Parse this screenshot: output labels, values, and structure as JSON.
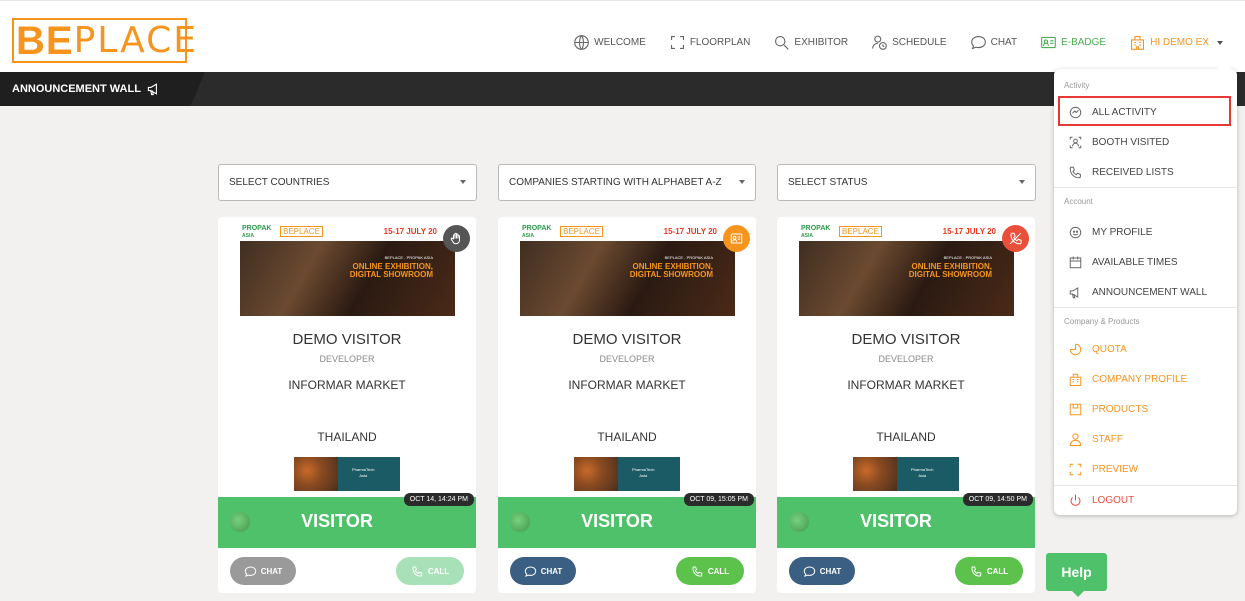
{
  "header": {
    "logo_be": "BE",
    "logo_place": "PLACE",
    "nav": [
      {
        "label": "WELCOME",
        "icon": "globe-icon"
      },
      {
        "label": "FLOORPLAN",
        "icon": "floorplan-icon"
      },
      {
        "label": "EXHIBITOR",
        "icon": "search-icon"
      },
      {
        "label": "SCHEDULE",
        "icon": "schedule-icon"
      },
      {
        "label": "CHAT",
        "icon": "chat-icon"
      },
      {
        "label": "E-BADGE",
        "icon": "badge-icon"
      },
      {
        "label": "HI DEMO EX",
        "icon": "building-icon"
      }
    ]
  },
  "announcement": {
    "label": "ANNOUNCEMENT WALL"
  },
  "filters": {
    "countries": "SELECT COUNTRIES",
    "alphabet": "COMPANIES STARTING WITH ALPHABET A-Z",
    "status": "SELECT STATUS"
  },
  "banner": {
    "propak": "PROPAK",
    "propak_sub": "ASIA",
    "beplace": "BEPLACE",
    "dates": "15-17 JULY 20",
    "small": "BEPLACE - PROPAK ASIA",
    "headline1": "ONLINE EXHIBITION,",
    "headline2": "DIGITAL SHOWROOM"
  },
  "thumb": {
    "line1": "PharmaTech",
    "line2": "Asia"
  },
  "cards": [
    {
      "name": "DEMO VISITOR",
      "role": "DEVELOPER",
      "company": "INFORMAR MARKET",
      "country": "THAILAND",
      "time": "OCT 14, 14:24 PM",
      "type": "VISITOR",
      "chat": "CHAT",
      "call": "CALL",
      "status_icon": "hand-icon",
      "status_color": "#555555",
      "chat_color": "#9a9a9a",
      "call_color": "#a8e0b8"
    },
    {
      "name": "DEMO VISITOR",
      "role": "DEVELOPER",
      "company": "INFORMAR MARKET",
      "country": "THAILAND",
      "time": "OCT 09, 15:05 PM",
      "type": "VISITOR",
      "chat": "CHAT",
      "call": "CALL",
      "status_icon": "id-card-icon",
      "status_color": "#f7941d",
      "chat_color": "#3b5f82",
      "call_color": "#5cc24b"
    },
    {
      "name": "DEMO VISITOR",
      "role": "DEVELOPER",
      "company": "INFORMAR MARKET",
      "country": "THAILAND",
      "time": "OCT 09, 14:50 PM",
      "type": "VISITOR",
      "chat": "CHAT",
      "call": "CALL",
      "status_icon": "phone-off-icon",
      "status_color": "#e8503a",
      "chat_color": "#3b5f82",
      "call_color": "#5cc24b"
    }
  ],
  "dropdown": {
    "section_activity": "Activity",
    "all_activity": "ALL ACTIVITY",
    "booth_visited": "BOOTH VISITED",
    "received_lists": "RECEIVED LISTS",
    "section_account": "Account",
    "my_profile": "MY PROFILE",
    "available_times": "AVAILABLE TIMES",
    "announcement_wall": "ANNOUNCEMENT WALL",
    "section_company": "Company & Products",
    "quota": "QUOTA",
    "company_profile": "COMPANY PROFILE",
    "products": "PRODUCTS",
    "staff": "STAFF",
    "preview": "PREVIEW",
    "logout": "LOGOUT"
  },
  "help": {
    "label": "Help"
  },
  "colors": {
    "brand_orange": "#f7941d",
    "visitor_green": "#4fc16a",
    "dark_bar": "#2b2b2b",
    "highlight_red": "#e53935"
  }
}
